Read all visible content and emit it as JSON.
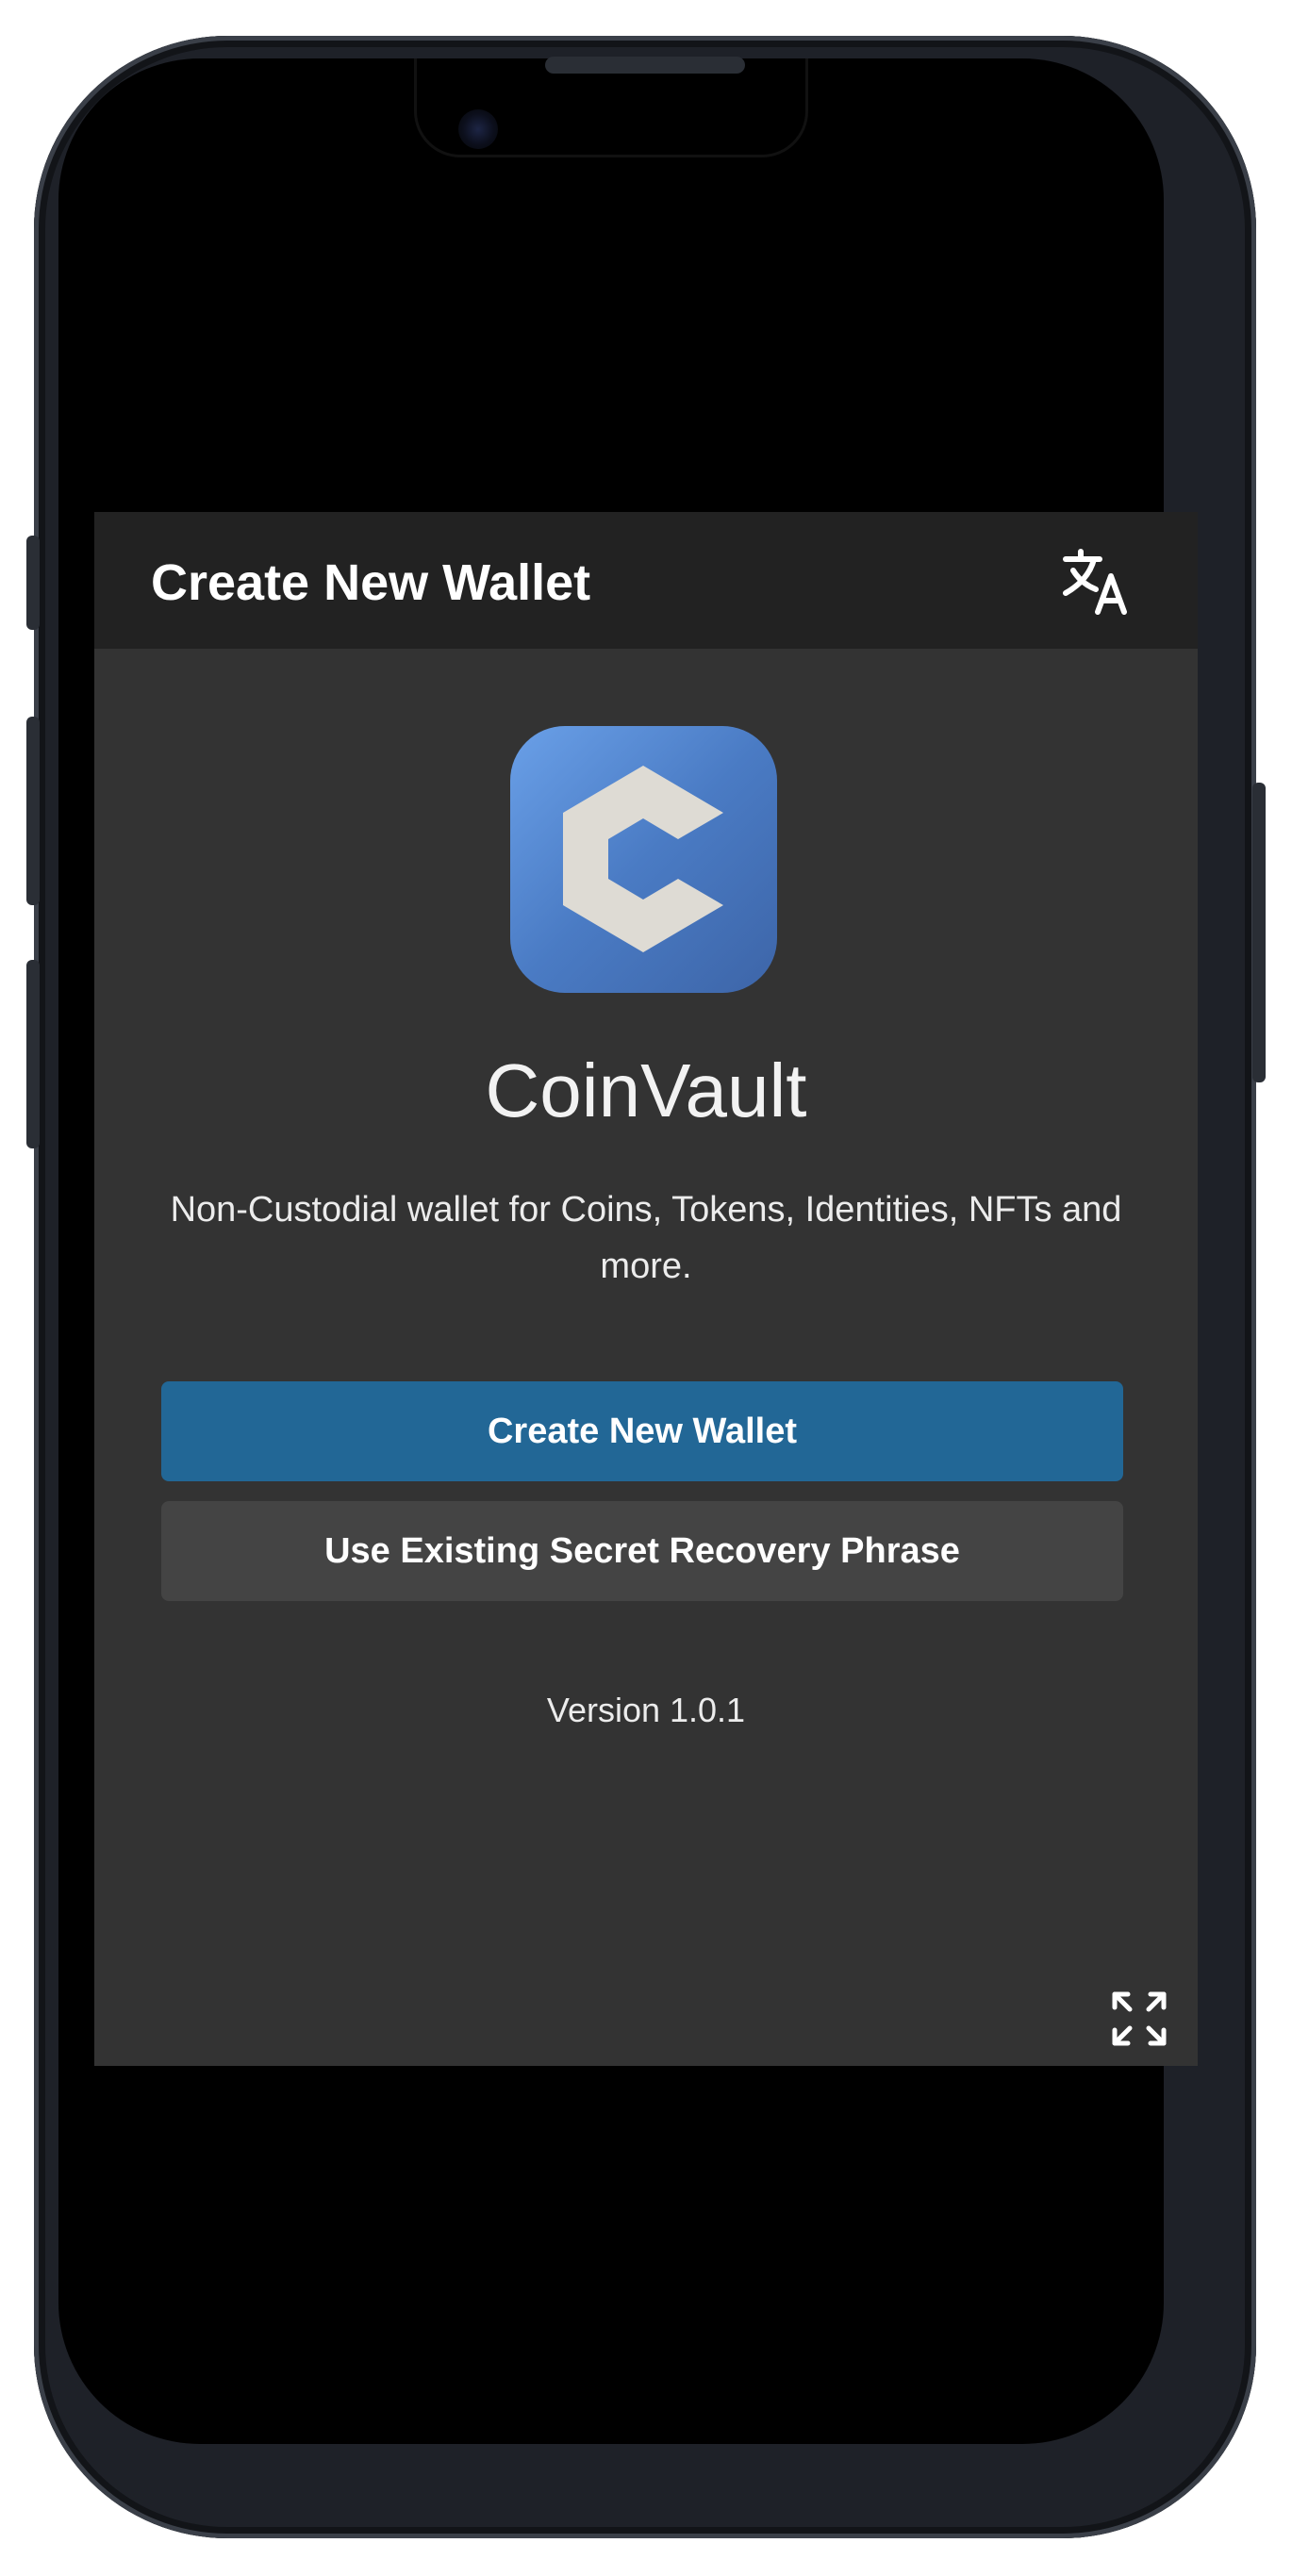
{
  "header": {
    "title": "Create New Wallet",
    "translate_icon": "translate-icon"
  },
  "brand": {
    "logo_icon": "coinvault-logo-icon",
    "name": "CoinVault",
    "tagline": "Non-Custodial wallet for Coins, Tokens, Identities, NFTs and more."
  },
  "actions": {
    "create_label": "Create New Wallet",
    "existing_label": "Use Existing Secret Recovery Phrase"
  },
  "footer": {
    "version": "Version 1.0.1",
    "expand_icon": "fullscreen-icon"
  },
  "colors": {
    "header_bg": "#222222",
    "body_bg": "#333333",
    "primary_button": "#226796",
    "secondary_button": "#444444",
    "logo_blue": "#5a8fd8",
    "logo_glyph": "#dedbd4"
  }
}
